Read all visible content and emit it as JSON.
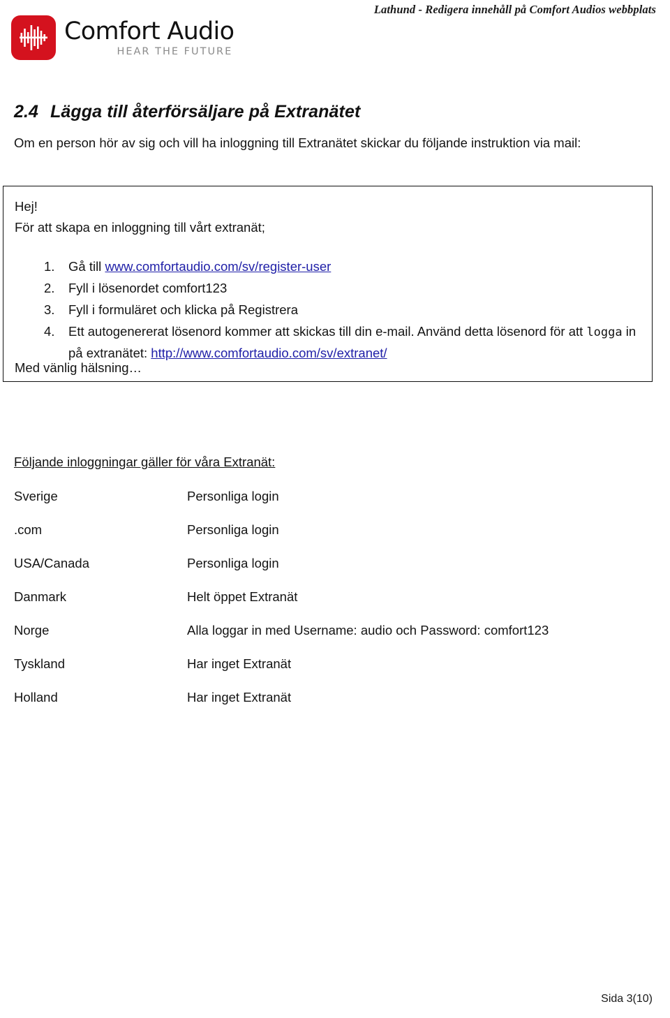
{
  "header": {
    "running_title": "Lathund - Redigera innehåll på Comfort Audios webbplats"
  },
  "logo": {
    "name": "Comfort Audio",
    "tagline": "HEAR THE FUTURE",
    "mark_color": "#d4121e",
    "icon": "audio-waveform-icon"
  },
  "section": {
    "number": "2.4",
    "title": "Lägga till återförsäljare på Extranätet",
    "intro": "Om en person hör av sig och vill ha inloggning till Extranätet skickar du följande instruktion via mail:"
  },
  "mail_box": {
    "greeting": "Hej!",
    "subline": "För att skapa en inloggning till vårt extranät;",
    "steps": [
      {
        "marker": "1.",
        "prefix": "Gå till ",
        "link": "www.comfortaudio.com/sv/register-user",
        "suffix": ""
      },
      {
        "marker": "2.",
        "prefix": "Fyll i lösenordet comfort123",
        "link": "",
        "suffix": ""
      },
      {
        "marker": "3.",
        "prefix": "Fyll i formuläret och klicka på Registrera",
        "link": "",
        "suffix": ""
      },
      {
        "marker": "4.",
        "prefix": "Ett autogenererat lösenord kommer att skickas till din e-mail. Använd detta lösenord för att ",
        "mono_word": "logga",
        "middle": " in på extranätet: ",
        "link": "http://www.comfortaudio.com/sv/extranet/",
        "suffix": ""
      }
    ],
    "signoff": "Med vänlig hälsning…",
    "link_color": "#2020a8"
  },
  "login_table": {
    "title": "Följande inloggningar gäller för våra Extranät:",
    "rows": [
      {
        "region": "Sverige",
        "access": "Personliga login"
      },
      {
        "region": ".com",
        "access": "Personliga login"
      },
      {
        "region": "USA/Canada",
        "access": "Personliga login"
      },
      {
        "region": "Danmark",
        "access": "Helt öppet Extranät"
      },
      {
        "region": "Norge",
        "access": "Alla loggar in med Username: audio och Password: comfort123"
      },
      {
        "region": "Tyskland",
        "access": "Har inget Extranät"
      },
      {
        "region": "Holland",
        "access": "Har inget Extranät"
      }
    ]
  },
  "footer": {
    "page_label": "Sida 3(10)"
  }
}
